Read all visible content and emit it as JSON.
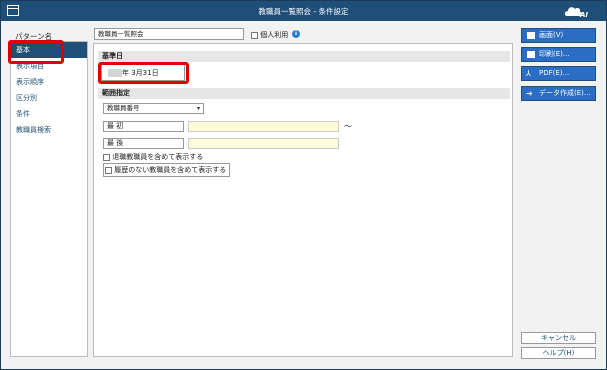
{
  "window": {
    "title": "教職員一覧照会 - 条件設定",
    "logo_text": "AI"
  },
  "pattern": {
    "label": "パターン名",
    "value": "教職員一覧照会",
    "personal_label": "個人利用"
  },
  "sidebar": {
    "items": [
      "基本",
      "表示項目",
      "表示順序",
      "区分別",
      "条件",
      "教職員検索"
    ]
  },
  "base_date": {
    "header": "基準日",
    "suffix": "年  3月31日"
  },
  "range": {
    "header": "範囲指定",
    "field_selected": "教職員番号",
    "first_label": "最 初",
    "last_label": "最 後",
    "tilde": "～",
    "option1": "退職教職員を含めて表示する",
    "option2": "履歴のない教職員を含めて表示する"
  },
  "buttons": {
    "screen": "画面(V)",
    "print": "印刷(E)...",
    "pdf": "PDF(E)...",
    "data": "データ作成(E)...",
    "cancel": "キャンセル",
    "help": "ヘルプ(H)"
  }
}
